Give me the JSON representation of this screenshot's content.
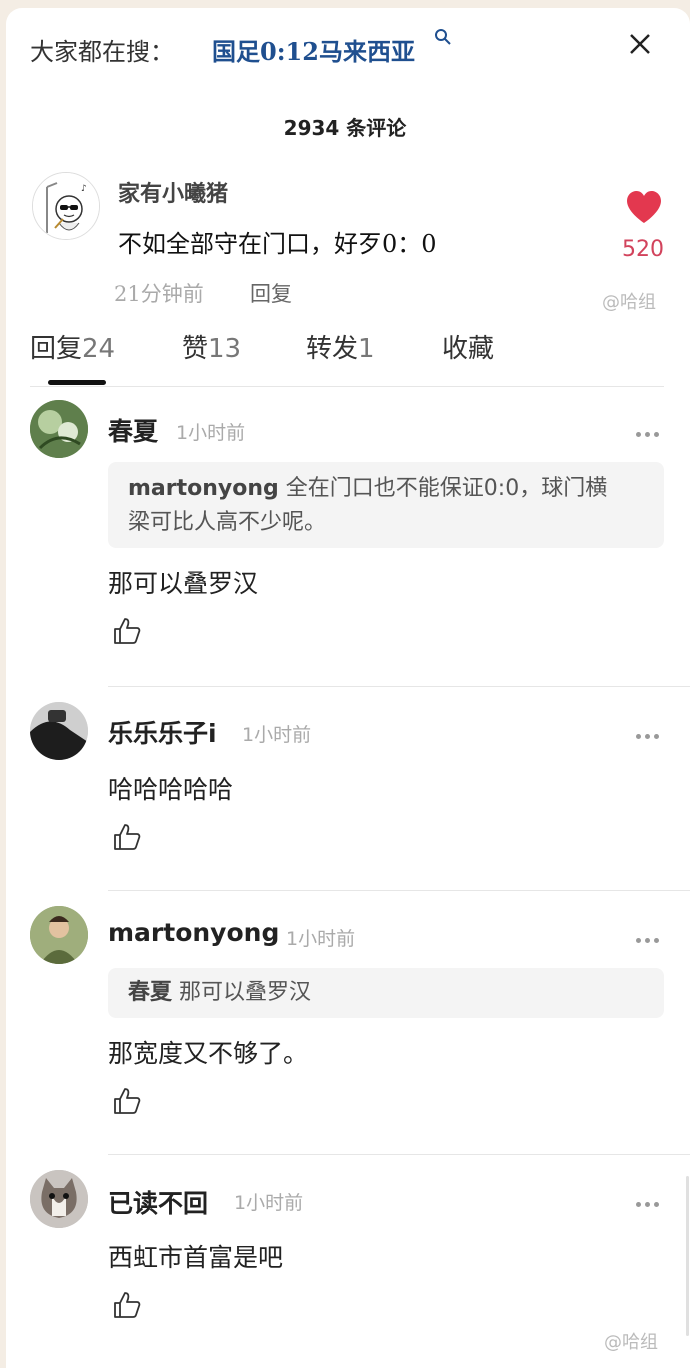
{
  "header": {
    "search_prefix": "大家都在搜：",
    "search_term": "国足0:12马来西亚"
  },
  "comment_count": "2934 条评论",
  "main_comment": {
    "author": "家有小曦猪",
    "text": "不如全部守在门口，好歹0：0",
    "time": "21分钟前",
    "reply_label": "回复",
    "likes": "520"
  },
  "tabs": [
    {
      "label": "回复",
      "count": "24"
    },
    {
      "label": "赞",
      "count": "13"
    },
    {
      "label": "转发",
      "count": "1"
    },
    {
      "label": "收藏",
      "count": ""
    }
  ],
  "watermark": "@哈组",
  "replies": [
    {
      "name": "春夏",
      "time": "1小时前",
      "quote_author": "martonyong",
      "quote_line1": "全在门口也不能保证0:0，球门横",
      "quote_line2": "梁可比人高不少呢。",
      "text": "那可以叠罗汉"
    },
    {
      "name": "乐乐乐子i",
      "time": "1小时前",
      "text": "哈哈哈哈哈"
    },
    {
      "name": "martonyong",
      "time": "1小时前",
      "quote_author": "春夏",
      "quote_line1": "那可以叠罗汉",
      "text": "那宽度又不够了。"
    },
    {
      "name": "已读不回",
      "time": "1小时前",
      "text": "西虹市首富是吧"
    }
  ],
  "colors": {
    "accent_link": "#1f4f8f",
    "like_red": "#e3384f"
  }
}
